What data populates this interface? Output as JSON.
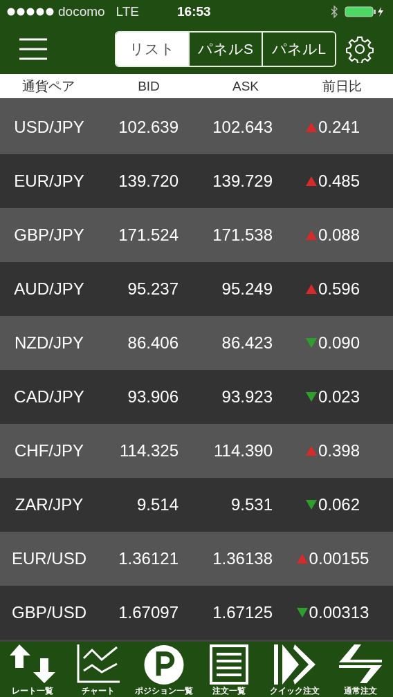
{
  "status_bar": {
    "carrier": "docomo",
    "network": "LTE",
    "time": "16:53"
  },
  "header": {
    "tabs": [
      {
        "label": "リスト",
        "selected": true
      },
      {
        "label": "パネルS",
        "selected": false
      },
      {
        "label": "パネルL",
        "selected": false
      }
    ]
  },
  "table": {
    "columns": [
      "通貨ペア",
      "BID",
      "ASK",
      "前日比"
    ],
    "rows": [
      {
        "pair": "USD/JPY",
        "bid": "102.639",
        "ask": "102.643",
        "kind": "up",
        "change": "0.241"
      },
      {
        "pair": "EUR/JPY",
        "bid": "139.720",
        "ask": "139.729",
        "kind": "up",
        "change": "0.485"
      },
      {
        "pair": "GBP/JPY",
        "bid": "171.524",
        "ask": "171.538",
        "kind": "up",
        "change": "0.088"
      },
      {
        "pair": "AUD/JPY",
        "bid": "95.237",
        "ask": "95.249",
        "kind": "up",
        "change": "0.596"
      },
      {
        "pair": "NZD/JPY",
        "bid": "86.406",
        "ask": "86.423",
        "kind": "down",
        "change": "0.090"
      },
      {
        "pair": "CAD/JPY",
        "bid": "93.906",
        "ask": "93.923",
        "kind": "down",
        "change": "0.023"
      },
      {
        "pair": "CHF/JPY",
        "bid": "114.325",
        "ask": "114.390",
        "kind": "up",
        "change": "0.398"
      },
      {
        "pair": "ZAR/JPY",
        "bid": "9.514",
        "ask": "9.531",
        "kind": "down",
        "change": "0.062"
      },
      {
        "pair": "EUR/USD",
        "bid": "1.36121",
        "ask": "1.36138",
        "kind": "up",
        "change": "0.00155"
      },
      {
        "pair": "GBP/USD",
        "bid": "1.67097",
        "ask": "1.67125",
        "kind": "down",
        "change": "0.00313"
      }
    ]
  },
  "tab_bar": [
    {
      "label": "レート一覧",
      "kind": "rates"
    },
    {
      "label": "チャート",
      "kind": "chart"
    },
    {
      "label": "ポジション一覧",
      "kind": "position"
    },
    {
      "label": "注文一覧",
      "kind": "orders"
    },
    {
      "label": "クイック注文",
      "kind": "quick"
    },
    {
      "label": "通常注文",
      "kind": "normal"
    }
  ]
}
